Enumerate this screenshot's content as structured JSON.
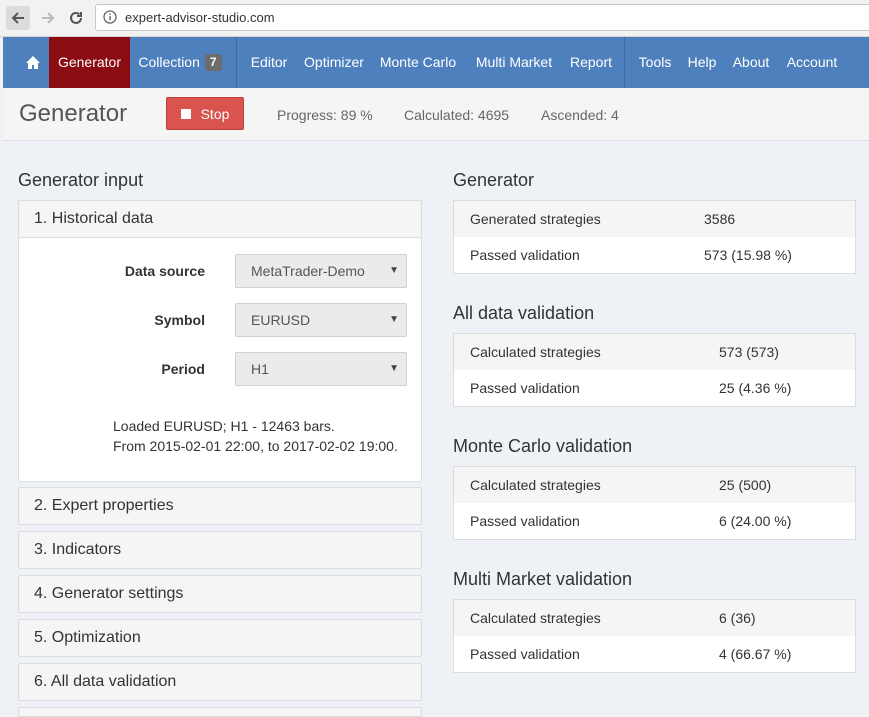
{
  "browser": {
    "url": "expert-advisor-studio.com"
  },
  "nav": {
    "generator": "Generator",
    "collection": "Collection",
    "collection_count": "7",
    "editor": "Editor",
    "optimizer": "Optimizer",
    "monte_carlo": "Monte Carlo",
    "multi_market": "Multi Market",
    "report": "Report",
    "tools": "Tools",
    "help": "Help",
    "about": "About",
    "account": "Account"
  },
  "status": {
    "title": "Generator",
    "stop_label": "Stop",
    "progress": "Progress: 89 %",
    "calculated": "Calculated: 4695",
    "ascended": "Ascended: 4"
  },
  "generator_input": {
    "heading": "Generator input",
    "panels": [
      "1. Historical data",
      "2. Expert properties",
      "3. Indicators",
      "4. Generator settings",
      "5. Optimization",
      "6. All data validation"
    ],
    "historical": {
      "data_source_label": "Data source",
      "data_source_value": "MetaTrader-Demo",
      "symbol_label": "Symbol",
      "symbol_value": "EURUSD",
      "period_label": "Period",
      "period_value": "H1",
      "loaded_line1": "Loaded EURUSD; H1 - 12463 bars.",
      "loaded_line2": "From 2015-02-01 22:00, to 2017-02-02 19:00."
    }
  },
  "results": {
    "generator": {
      "heading": "Generator",
      "rows": [
        {
          "label": "Generated strategies",
          "value": "3586"
        },
        {
          "label": "Passed validation",
          "value": "573 (15.98 %)"
        }
      ]
    },
    "all_data": {
      "heading": "All data validation",
      "rows": [
        {
          "label": "Calculated strategies",
          "value": "573 (573)"
        },
        {
          "label": "Passed validation",
          "value": "25 (4.36 %)"
        }
      ]
    },
    "monte_carlo": {
      "heading": "Monte Carlo validation",
      "rows": [
        {
          "label": "Calculated strategies",
          "value": "25 (500)"
        },
        {
          "label": "Passed validation",
          "value": "6 (24.00 %)"
        }
      ]
    },
    "multi_market": {
      "heading": "Multi Market validation",
      "rows": [
        {
          "label": "Calculated strategies",
          "value": "6 (36)"
        },
        {
          "label": "Passed validation",
          "value": "4 (66.67 %)"
        }
      ]
    }
  }
}
